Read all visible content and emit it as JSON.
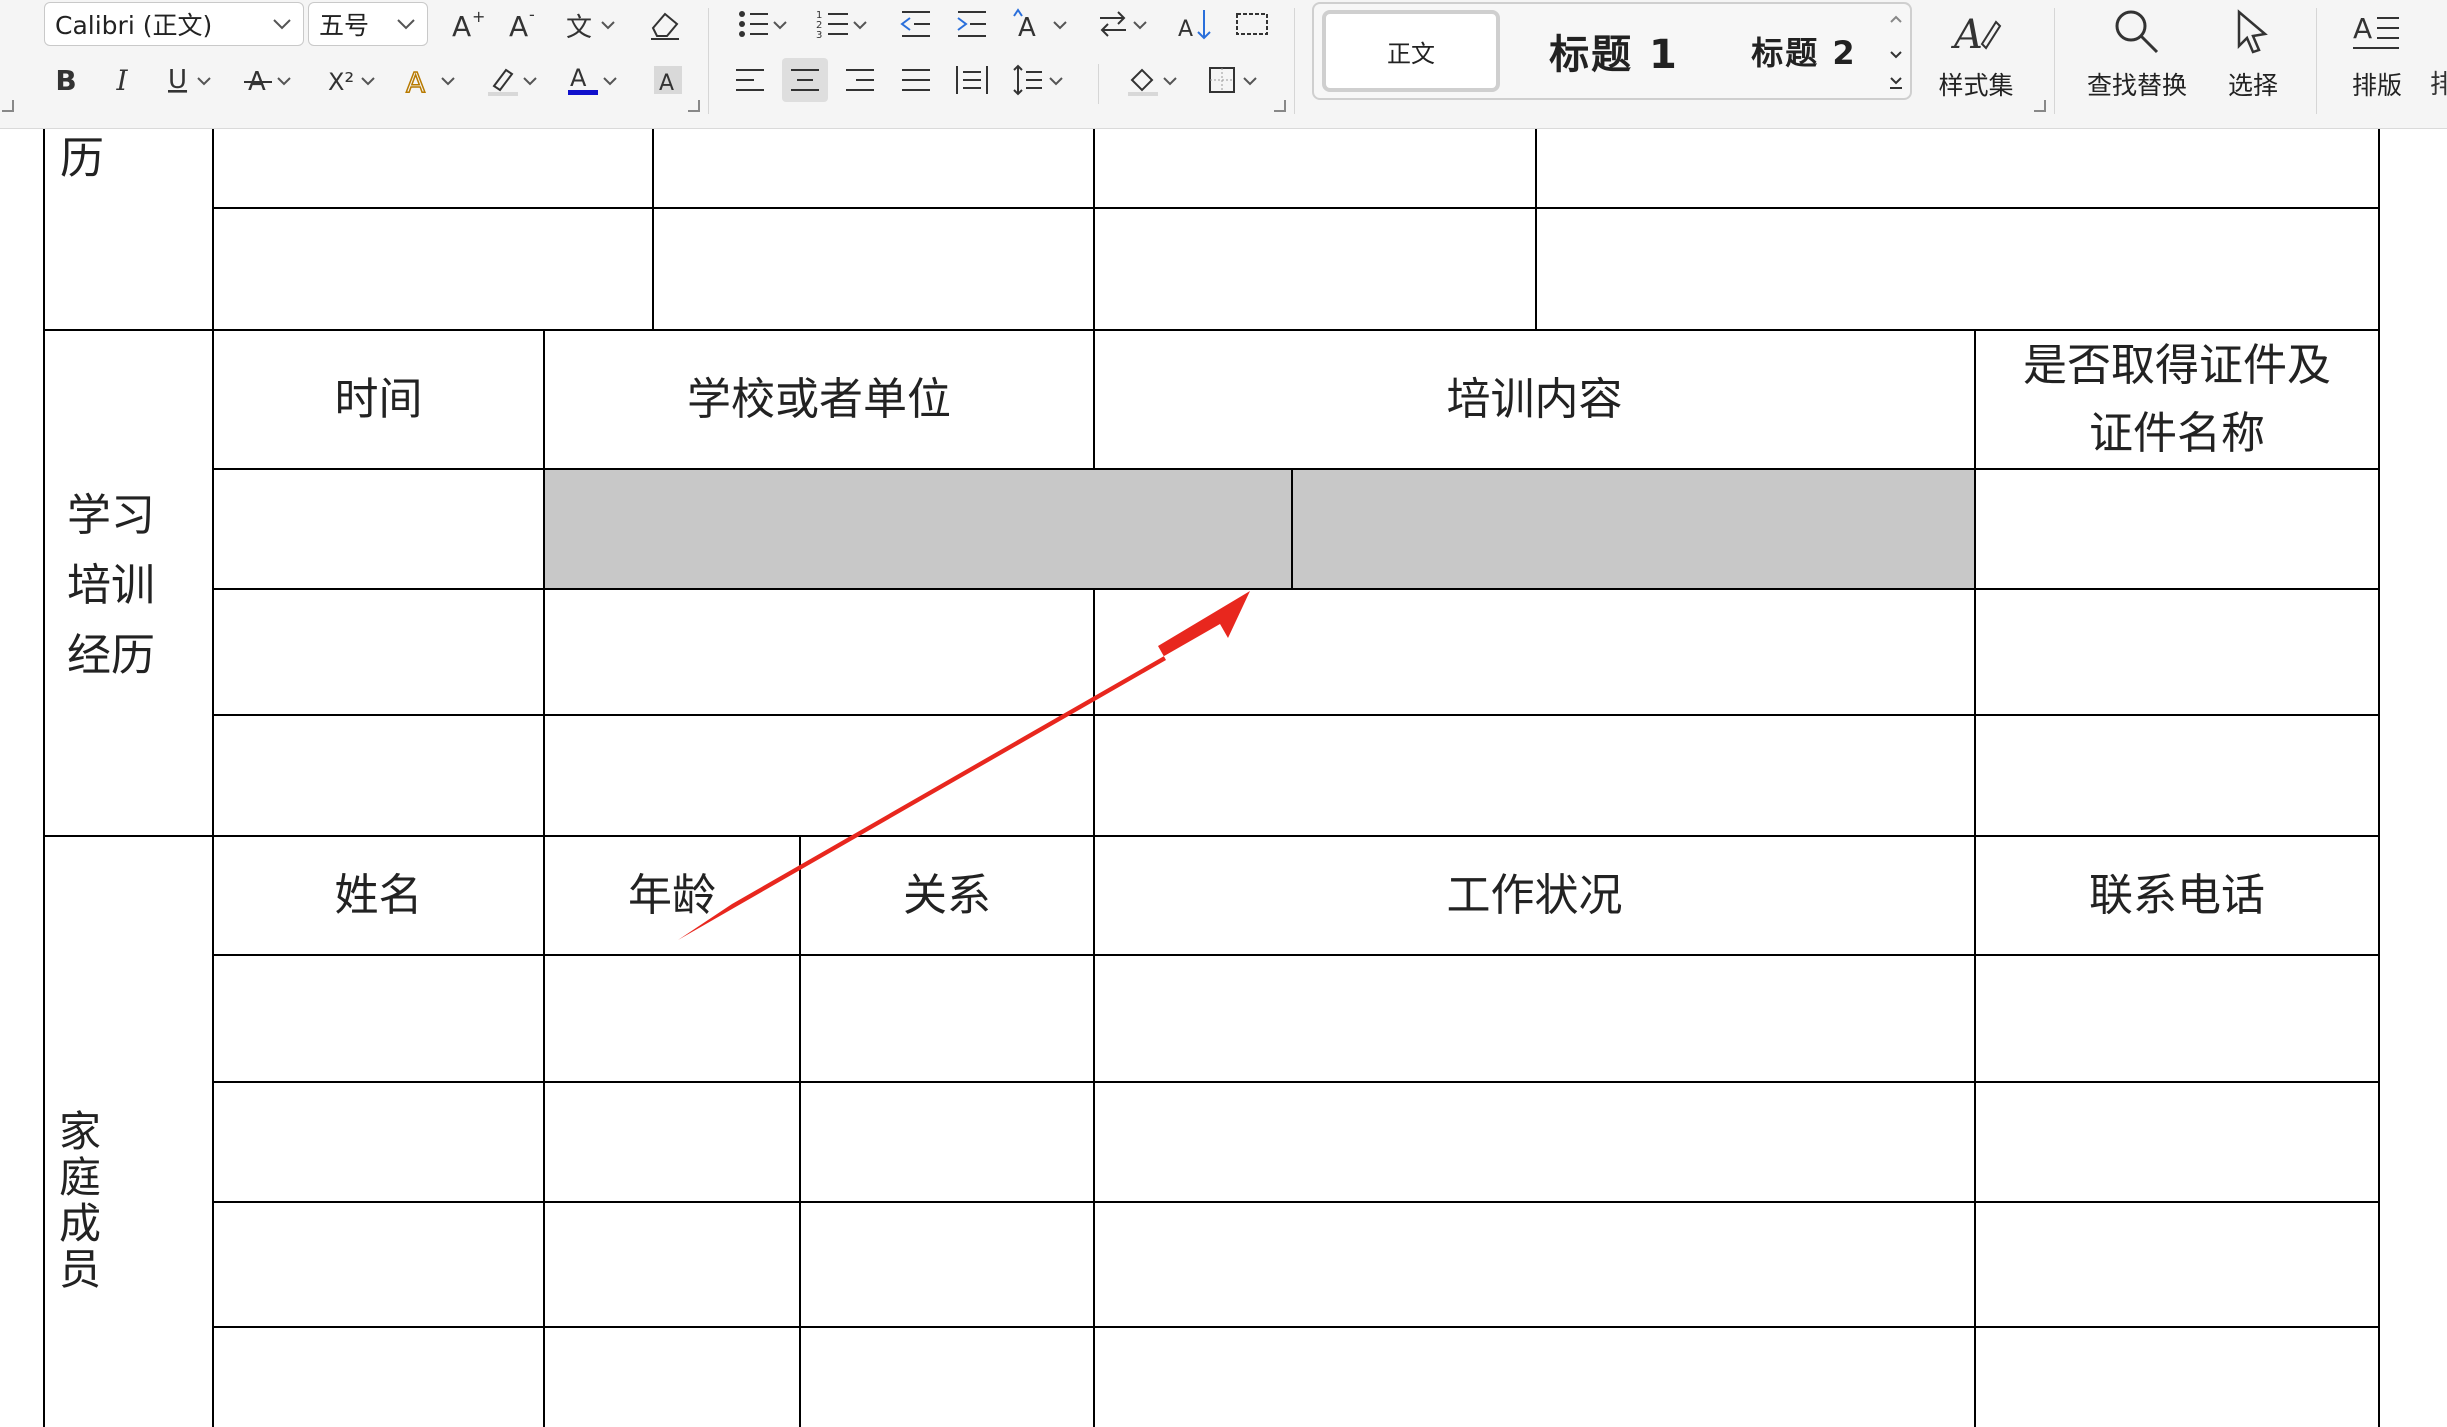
{
  "toolbar": {
    "font_name": "Calibri (正文)",
    "font_size": "五号",
    "styles": {
      "normal": "正文",
      "heading1": "标题 1",
      "heading2": "标题 2"
    },
    "style_set_label": "样式集",
    "find_replace_label": "查找替换",
    "select_label": "选择",
    "layout_label": "排版",
    "truncated_label": "排"
  },
  "table": {
    "section_resume_tail": "历",
    "section_training": "学习培训经历",
    "section_training_lines": [
      "学习",
      "培训",
      "经历"
    ],
    "section_family_lines": [
      "家",
      "庭",
      "成",
      "员"
    ],
    "training_headers": {
      "time": "时间",
      "school": "学校或者单位",
      "content": "培训内容",
      "certificate_line1": "是否取得证件及",
      "certificate_line2": "证件名称"
    },
    "family_headers": {
      "name": "姓名",
      "age": "年龄",
      "relation": "关系",
      "work": "工作状况",
      "phone": "联系电话"
    }
  },
  "annotation": {
    "arrow_color": "#e8271e",
    "selected_cells_color": "#c8c8c8"
  }
}
